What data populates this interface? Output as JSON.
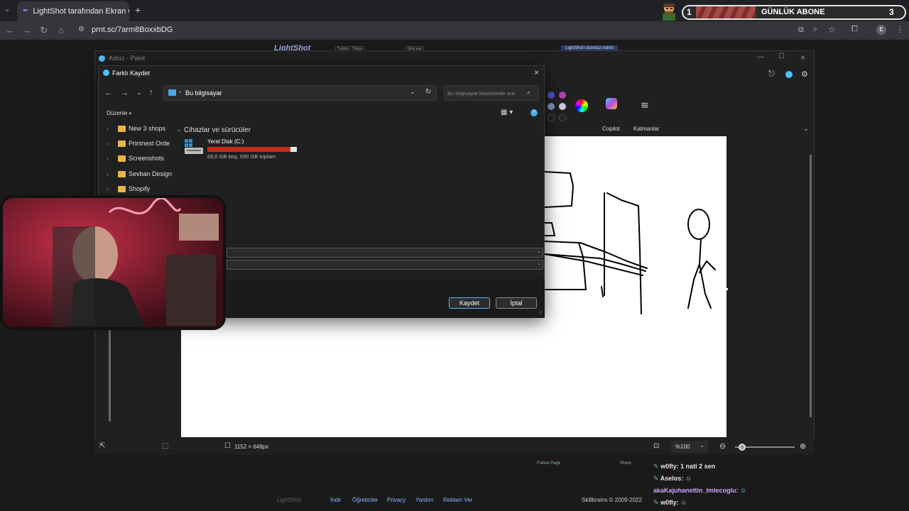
{
  "browser": {
    "tab_title": "LightShot tarafından Ekran Görü",
    "url": "prnt.sc/7arm8BoxxbDG"
  },
  "stream_badge": {
    "left_number": "1",
    "label": "GÜNLÜK ABONE",
    "right_number": "3"
  },
  "lightshot_page": {
    "logo": "LightShot",
    "lang": "Turkish - Türkçe",
    "login": "Giriş yap",
    "download_cta": "LightShot'ı ücretsiz indirin",
    "follow_page": "Follow Page",
    "share": "Share",
    "footer_logo": "LightShot",
    "footer_links": [
      "İndir",
      "Öğreticiler",
      "Privacy",
      "Yardım",
      "Reklam Ver"
    ],
    "footer_copy": "Skillbrains © 2009-2022"
  },
  "paint": {
    "title": "Adsız - Paint",
    "copilot_label": "Copilot",
    "layers_label": "Katmanlar",
    "canvas_size": "1152 × 648px",
    "zoom": "%100"
  },
  "dialog": {
    "title": "Farklı Kaydet",
    "location": "Bu bilgisayar",
    "search_placeholder": "Bu bilgisayar klasöründe ara",
    "organize": "Düzenle",
    "section_title": "Cihazlar ve sürücüler",
    "drive_name": "Yerel Disk (C:)",
    "drive_info": "69,0 GB boş, 930 GB toplam",
    "drive_used_fraction": 0.926,
    "tree": [
      "New 3 shops",
      "Printnest Orde",
      "Screenshots",
      "Sevban Design",
      "Shopify"
    ],
    "save_button": "Kaydet",
    "cancel_button": "İptal"
  },
  "chat": [
    {
      "user": "w0fly:",
      "message": "1 nati 2 sen"
    },
    {
      "user": "Aselos:",
      "message": ""
    },
    {
      "user": "akaKajuhanettin_Imlecoglu:",
      "message": ""
    },
    {
      "user": "w0fly:",
      "message": ""
    }
  ],
  "colors": {
    "accent": "#4cc2ff",
    "drive_bar": "#c42b1c",
    "link": "#8fb5ff"
  }
}
